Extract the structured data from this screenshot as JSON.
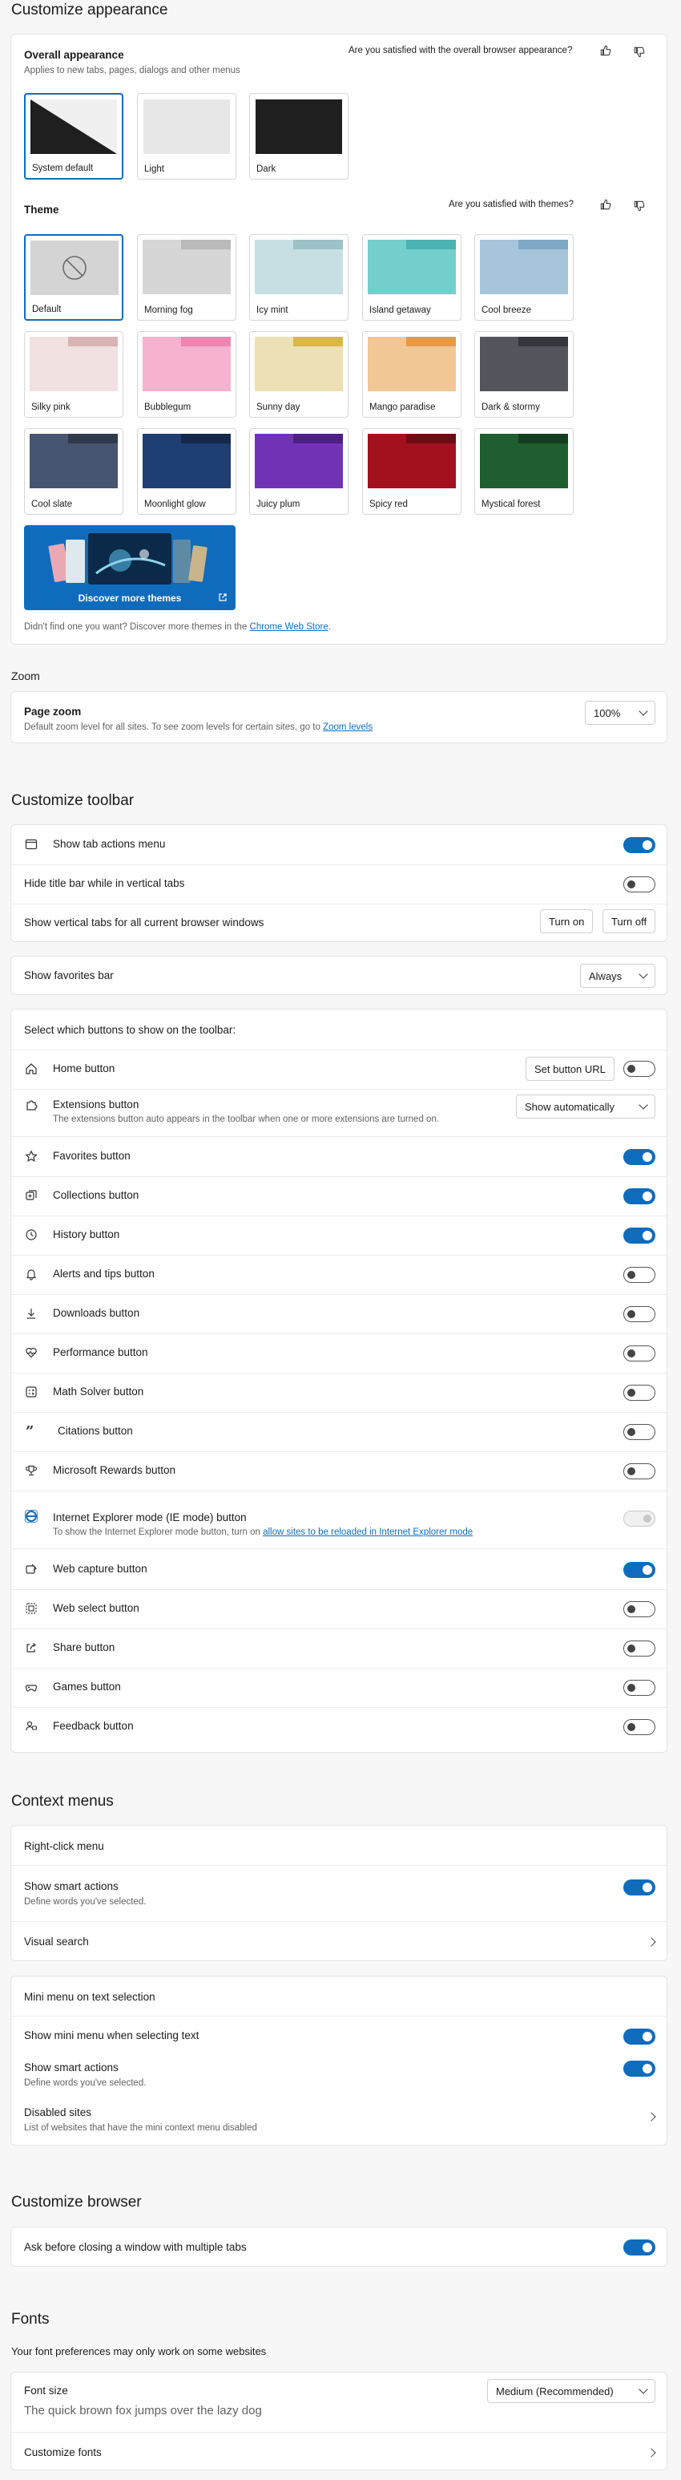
{
  "appearance": {
    "heading": "Customize appearance",
    "overall_title": "Overall appearance",
    "overall_sub": "Applies to new tabs, pages, dialogs and other menus",
    "feedback_q": "Are you satisfied with the overall browser appearance?",
    "modes": [
      {
        "label": "System default",
        "selected": true
      },
      {
        "label": "Light",
        "selected": false
      },
      {
        "label": "Dark",
        "selected": false
      }
    ],
    "theme_title": "Theme",
    "theme_q": "Are you satisfied with themes?",
    "themes": [
      {
        "label": "Default",
        "color": "#d4d4d4",
        "tab": "#bdbdbd",
        "selected": true
      },
      {
        "label": "Morning fog",
        "color": "#d6d6d6",
        "tab": "#b9b9b9",
        "selected": false
      },
      {
        "label": "Icy mint",
        "color": "#c7dfe3",
        "tab": "#9cc2c8",
        "selected": false
      },
      {
        "label": "Island getaway",
        "color": "#72cfcc",
        "tab": "#4bb3b1",
        "selected": false
      },
      {
        "label": "Cool breeze",
        "color": "#a6c5db",
        "tab": "#7ea8c6",
        "selected": false
      },
      {
        "label": "Silky pink",
        "color": "#f1e1e1",
        "tab": "#d8b4b4",
        "selected": false
      },
      {
        "label": "Bubblegum",
        "color": "#f5b3cf",
        "tab": "#ec86b1",
        "selected": false
      },
      {
        "label": "Sunny day",
        "color": "#ece0b4",
        "tab": "#d9b749",
        "selected": false
      },
      {
        "label": "Mango paradise",
        "color": "#f1c796",
        "tab": "#e59a49",
        "selected": false
      },
      {
        "label": "Dark & stormy",
        "color": "#52555c",
        "tab": "#33363b",
        "selected": false
      },
      {
        "label": "Cool slate",
        "color": "#485570",
        "tab": "#303a4d",
        "selected": false
      },
      {
        "label": "Moonlight glow",
        "color": "#1f3e72",
        "tab": "#14284b",
        "selected": false
      },
      {
        "label": "Juicy plum",
        "color": "#7133b5",
        "tab": "#4e1f84",
        "selected": false
      },
      {
        "label": "Spicy red",
        "color": "#a3111f",
        "tab": "#700b14",
        "selected": false
      },
      {
        "label": "Mystical forest",
        "color": "#1f5e2e",
        "tab": "#143f1e",
        "selected": false
      }
    ],
    "discover_label": "Discover more themes",
    "chrome_note_pre": "Didn't find one you want? Discover more themes in the ",
    "chrome_link": "Chrome Web Store",
    "chrome_note_post": "."
  },
  "zoom": {
    "heading": "Zoom",
    "page_zoom_title": "Page zoom",
    "page_zoom_sub_pre": "Default zoom level for all sites. To see zoom levels for certain sites, go to ",
    "page_zoom_link": "Zoom levels",
    "value": "100%"
  },
  "toolbar": {
    "heading": "Customize toolbar",
    "tab_actions": {
      "label": "Show tab actions menu",
      "on": true
    },
    "hide_title": {
      "label": "Hide title bar while in vertical tabs",
      "on": false
    },
    "vertical_tabs": {
      "label": "Show vertical tabs for all current browser windows",
      "turn_on": "Turn on",
      "turn_off": "Turn off"
    },
    "favorites_bar": {
      "label": "Show favorites bar",
      "value": "Always"
    },
    "select_heading": "Select which buttons to show on the toolbar:",
    "home": {
      "label": "Home button",
      "set_url": "Set button URL",
      "on": false
    },
    "extensions": {
      "label": "Extensions button",
      "sub": "The extensions button auto appears in the toolbar when one or more extensions are turned on.",
      "value": "Show automatically"
    },
    "buttons": [
      {
        "label": "Favorites button",
        "icon": "star-icon",
        "on": true
      },
      {
        "label": "Collections button",
        "icon": "collections-icon",
        "on": true
      },
      {
        "label": "History button",
        "icon": "history-icon",
        "on": true
      },
      {
        "label": "Alerts and tips button",
        "icon": "bell-icon",
        "on": false
      },
      {
        "label": "Downloads button",
        "icon": "download-icon",
        "on": false
      },
      {
        "label": "Performance button",
        "icon": "heartbeat-icon",
        "on": false
      },
      {
        "label": "Math Solver button",
        "icon": "math-icon",
        "on": false
      },
      {
        "label": "Citations button",
        "icon": "quote-icon",
        "on": false
      },
      {
        "label": "Microsoft Rewards button",
        "icon": "trophy-icon",
        "on": false
      }
    ],
    "ie_mode": {
      "label": "Internet Explorer mode (IE mode) button",
      "sub_pre": "To show the Internet Explorer mode button, turn on ",
      "sub_link": "allow sites to be reloaded in Internet Explorer mode"
    },
    "buttons2": [
      {
        "label": "Web capture button",
        "icon": "capture-icon",
        "on": true
      },
      {
        "label": "Web select button",
        "icon": "web-select-icon",
        "on": false
      },
      {
        "label": "Share button",
        "icon": "share-icon",
        "on": false
      },
      {
        "label": "Games button",
        "icon": "games-icon",
        "on": false
      },
      {
        "label": "Feedback button",
        "icon": "feedback-icon",
        "on": false
      }
    ]
  },
  "context": {
    "heading": "Context menus",
    "right_click_title": "Right-click menu",
    "smart_actions": {
      "label": "Show smart actions",
      "sub": "Define words you've selected.",
      "on": true
    },
    "visual_search": "Visual search",
    "mini_title": "Mini menu on text selection",
    "mini_show": {
      "label": "Show mini menu when selecting text",
      "on": true
    },
    "mini_smart": {
      "label": "Show smart actions",
      "sub": "Define words you've selected.",
      "on": true
    },
    "disabled_sites": {
      "label": "Disabled sites",
      "sub": "List of websites that have the mini context menu disabled"
    }
  },
  "browser": {
    "heading": "Customize browser",
    "ask_close": {
      "label": "Ask before closing a window with multiple tabs",
      "on": true
    }
  },
  "fonts": {
    "heading": "Fonts",
    "note": "Your font preferences may only work on some websites",
    "size_title": "Font size",
    "sample": "The quick brown fox jumps over the lazy dog",
    "size_value": "Medium (Recommended)",
    "customize": "Customize fonts"
  }
}
